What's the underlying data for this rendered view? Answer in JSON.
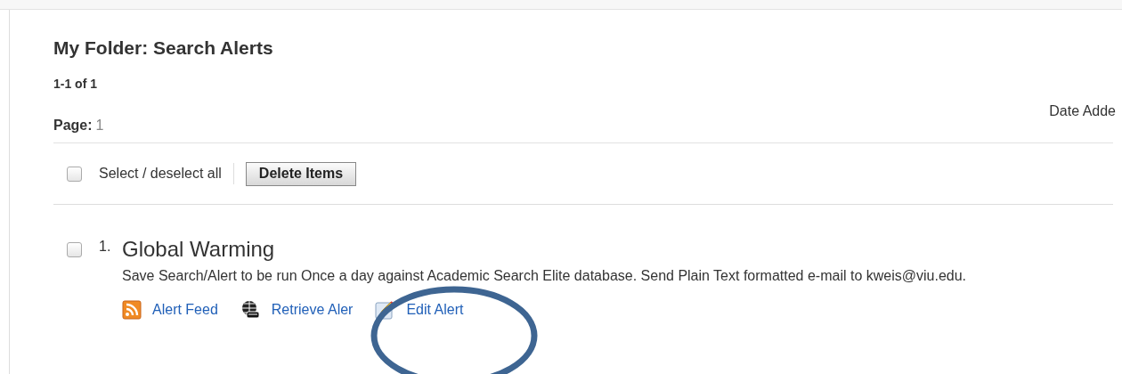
{
  "header": {
    "title": "My Folder: Search Alerts",
    "count": "1-1 of 1",
    "page_label": "Page:",
    "page_number": "1",
    "sort_label": "Date Adde"
  },
  "toolbar": {
    "select_all_label": "Select / deselect all",
    "select_all_checked": false,
    "delete_button": "Delete Items"
  },
  "alerts": [
    {
      "number": "1.",
      "title": "Global Warming",
      "checked": false,
      "description": "Save Search/Alert to be run Once a day against Academic Search Elite database. Send Plain Text formatted e-mail to kweis@viu.edu.",
      "actions": [
        {
          "kind": "feed",
          "label": "Alert Feed"
        },
        {
          "kind": "retrieve",
          "label": "Retrieve Aler"
        },
        {
          "kind": "edit",
          "label": "Edit Alert"
        }
      ]
    }
  ]
}
